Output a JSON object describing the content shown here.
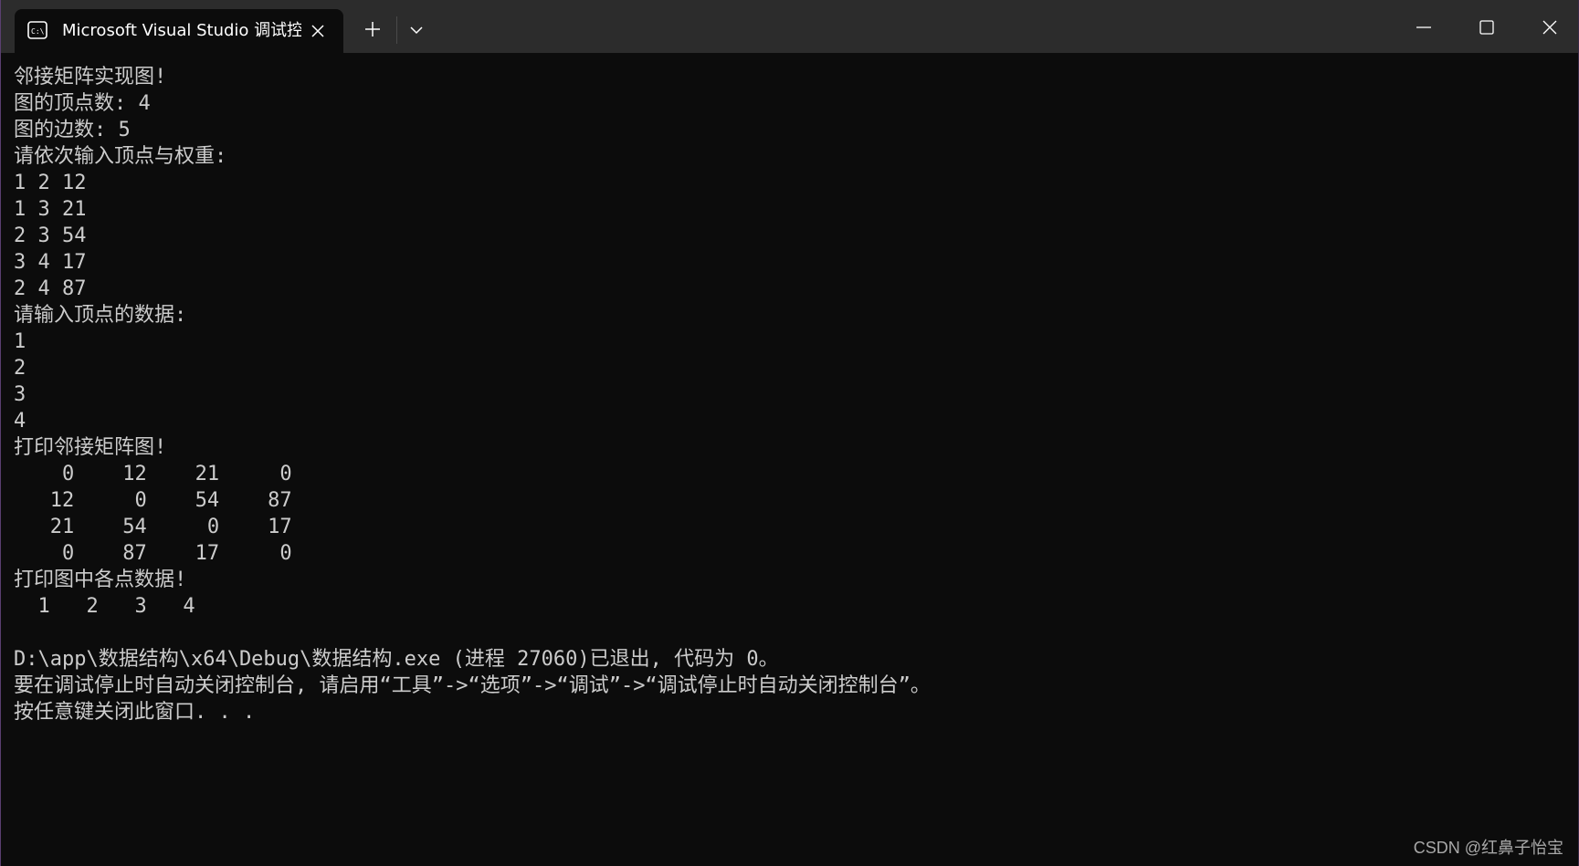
{
  "tab": {
    "title": "Microsoft Visual Studio 调试控制台",
    "icon": "terminal-icon"
  },
  "titlebar": {
    "new_tab_icon": "plus-icon",
    "dropdown_icon": "chevron-down-icon",
    "minimize_icon": "minimize-icon",
    "maximize_icon": "maximize-icon",
    "close_icon": "close-icon"
  },
  "console": {
    "lines": [
      "邻接矩阵实现图!",
      "图的顶点数: 4",
      "图的边数: 5",
      "请依次输入顶点与权重:",
      "1 2 12",
      "1 3 21",
      "2 3 54",
      "3 4 17",
      "2 4 87",
      "请输入顶点的数据:",
      "1",
      "2",
      "3",
      "4",
      "打印邻接矩阵图!",
      "    0    12    21     0",
      "   12     0    54    87",
      "   21    54     0    17",
      "    0    87    17     0",
      "打印图中各点数据!",
      "  1   2   3   4",
      "",
      "D:\\app\\数据结构\\x64\\Debug\\数据结构.exe (进程 27060)已退出, 代码为 0。",
      "要在调试停止时自动关闭控制台, 请启用“工具”->“选项”->“调试”->“调试停止时自动关闭控制台”。",
      "按任意键关闭此窗口. . ."
    ]
  },
  "watermark": "CSDN @红鼻子怡宝",
  "colors": {
    "background": "#0c0c0c",
    "titlebar": "#2c2c2c",
    "text": "#cccccc"
  }
}
